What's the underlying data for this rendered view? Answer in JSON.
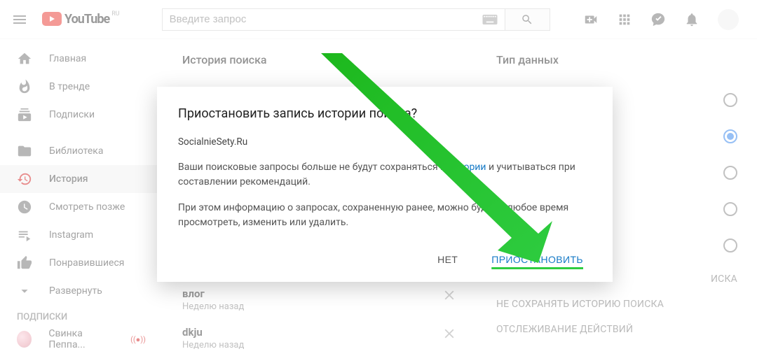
{
  "header": {
    "logo_text": "YouTube",
    "region": "RU",
    "search_placeholder": "Введите запрос"
  },
  "sidebar": {
    "items": [
      {
        "label": "Главная",
        "icon": "home"
      },
      {
        "label": "В тренде",
        "icon": "trending"
      },
      {
        "label": "Подписки",
        "icon": "subs"
      }
    ],
    "library": [
      {
        "label": "Библиотека",
        "icon": "folder"
      },
      {
        "label": "История",
        "icon": "history",
        "active": true
      },
      {
        "label": "Смотреть позже",
        "icon": "clock"
      },
      {
        "label": "Instagram",
        "icon": "playlist"
      },
      {
        "label": "Понравившиеся",
        "icon": "like"
      },
      {
        "label": "Развернуть",
        "icon": "expand"
      }
    ],
    "section_title": "ПОДПИСКИ",
    "channel": {
      "label": "Свинка Пеппа..."
    }
  },
  "center": {
    "title": "История поиска",
    "items": [
      {
        "q": "влог",
        "t": "Неделю назад"
      },
      {
        "q": "dkju",
        "t": "Неделю назад"
      }
    ]
  },
  "right": {
    "title": "Тип данных",
    "radios": [
      {
        "selected": false
      },
      {
        "selected": true
      },
      {
        "selected": false
      },
      {
        "selected": false
      },
      {
        "selected": false
      }
    ],
    "links": [
      "ИСКА",
      "НЕ СОХРАНЯТЬ ИСТОРИЮ ПОИСКА",
      "ОТСЛЕЖИВАНИЕ ДЕЙСТВИЙ"
    ]
  },
  "modal": {
    "title": "Приостановить запись истории поиска?",
    "subtitle": "SocialnieSety.Ru",
    "p1_a": "Ваши поисковые запросы больше не будут сохраняться в ",
    "p1_link": "истории",
    "p1_b": " и учитываться при составлении рекомендаций.",
    "p2": "При этом информацию о запросах, сохраненную ранее, можно будет в любое время просмотреть, изменить или удалить.",
    "btn_no": "НЕТ",
    "btn_yes": "ПРИОСТАНОВИТЬ"
  }
}
